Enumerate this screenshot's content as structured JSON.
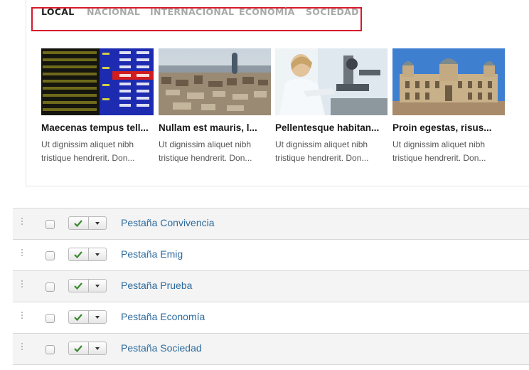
{
  "tabs": [
    {
      "label": "LOCAL",
      "active": true
    },
    {
      "label": "NACIONAL",
      "active": false
    },
    {
      "label": "INTERNACIONAL",
      "active": false
    },
    {
      "label": "ECONOMÍA",
      "active": false
    },
    {
      "label": "SOCIEDAD",
      "active": false
    }
  ],
  "articles": [
    {
      "title": "Maecenas tempus tell...",
      "excerpt_line1": "Ut dignissim aliquet nibh",
      "excerpt_line2": "tristique hendrerit. Don...",
      "image": "stock-board-image"
    },
    {
      "title": "Nullam est mauris, l...",
      "excerpt_line1": "Ut dignissim aliquet nibh",
      "excerpt_line2": "tristique hendrerit. Don...",
      "image": "city-skyline-image"
    },
    {
      "title": "Pellentesque habitan...",
      "excerpt_line1": "Ut dignissim aliquet nibh",
      "excerpt_line2": "tristique hendrerit. Don...",
      "image": "lab-scientist-image"
    },
    {
      "title": "Proin egestas, risus...",
      "excerpt_line1": "Ut dignissim aliquet nibh",
      "excerpt_line2": "tristique hendrerit. Don...",
      "image": "town-hall-image"
    }
  ],
  "rows": [
    {
      "label": "Pestaña Convivencia",
      "status_icon": "check-icon",
      "checked": false
    },
    {
      "label": "Pestaña Emig",
      "status_icon": "check-icon",
      "checked": false
    },
    {
      "label": "Pestaña Prueba",
      "status_icon": "check-icon",
      "checked": false
    },
    {
      "label": "Pestaña Economía",
      "status_icon": "check-icon",
      "checked": false
    },
    {
      "label": "Pestaña Sociedad",
      "status_icon": "check-icon",
      "checked": false
    }
  ],
  "colors": {
    "highlight_border": "#d7192b",
    "link": "#2d6b9e",
    "check": "#3a8a2e"
  }
}
